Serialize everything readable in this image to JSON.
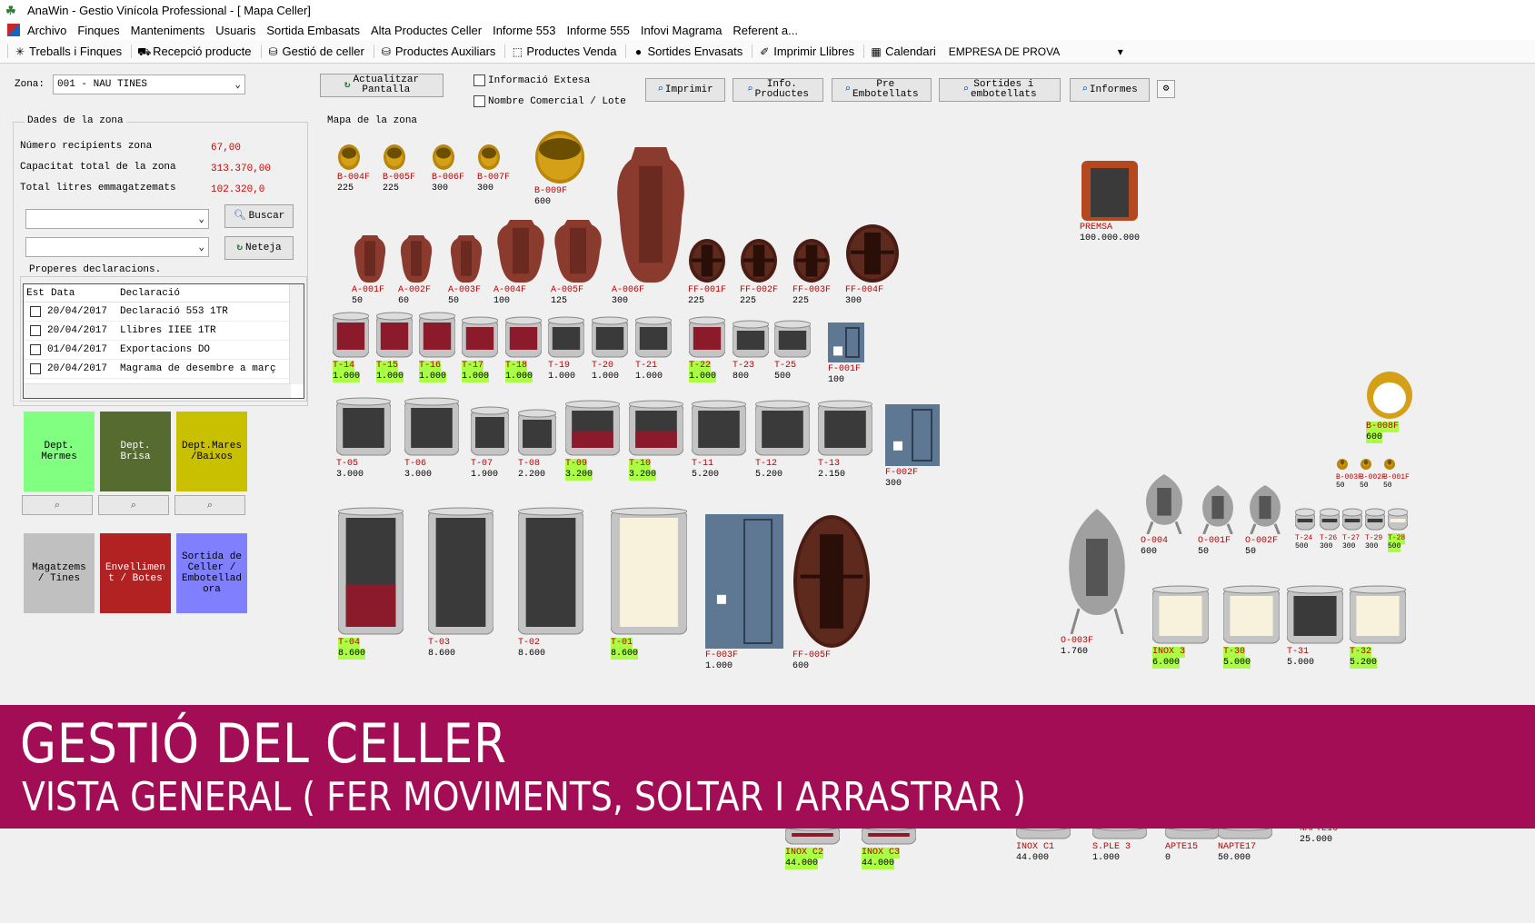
{
  "window": {
    "title": "AnaWin - Gestio Vinícola Professional - [   Mapa Celler]"
  },
  "menu": [
    "Archivo",
    "Finques",
    "Manteniments",
    "Usuaris",
    "Sortida Embasats",
    "Alta Productes Celler",
    "Informe 553",
    "Informe 555",
    "Infovi Magrama",
    "Referent a..."
  ],
  "toolbar": {
    "items": [
      {
        "label": "Treballs i Finques",
        "icon": "gear-icon"
      },
      {
        "label": "Recepció producte",
        "icon": "tractor-icon"
      },
      {
        "label": "Gestió de celler",
        "icon": "barrel-icon"
      },
      {
        "label": "Productes Auxiliars",
        "icon": "barrel-icon"
      },
      {
        "label": "Productes Venda",
        "icon": "box-icon"
      },
      {
        "label": "Sortides Envasats",
        "icon": "sale-icon"
      },
      {
        "label": "Imprimir Llibres",
        "icon": "book-icon"
      },
      {
        "label": "Calendari",
        "icon": "calendar-icon"
      }
    ],
    "company": "EMPRESA DE PROVA"
  },
  "top": {
    "zona_label": "Zona:",
    "zona_value": "001 - NAU TINES",
    "refresh_btn": [
      "Actualitzar",
      "Pantalla"
    ],
    "check_info": "Informació Extesa",
    "check_nom": "Nombre Comercial / Lote",
    "buttons": [
      {
        "l1": "Imprimir",
        "l2": ""
      },
      {
        "l1": "Info.",
        "l2": "Productes"
      },
      {
        "l1": "Pre",
        "l2": "Embotellats"
      },
      {
        "l1": "Sortides i",
        "l2": "embotellats"
      },
      {
        "l1": "Informes",
        "l2": ""
      }
    ]
  },
  "zone_data": {
    "title": "Dades de la zona",
    "rows": [
      {
        "label": "Número recipients zona",
        "value": "67,00"
      },
      {
        "label": "Capacitat total de la zona",
        "value": "313.370,00"
      },
      {
        "label": "Total litres emmagatzemats",
        "value": "102.320,0"
      }
    ],
    "buscar": "Buscar",
    "neteja": "Neteja"
  },
  "declarations": {
    "title": "Properes declaracions.",
    "headers": [
      "Est",
      "Data",
      "Declaració"
    ],
    "rows": [
      {
        "date": "20/04/2017",
        "text": "Declaració 553 1TR"
      },
      {
        "date": "20/04/2017",
        "text": "Llibres IIEE 1TR"
      },
      {
        "date": "01/04/2017",
        "text": "Exportacions DO"
      },
      {
        "date": "20/04/2017",
        "text": "Magrama de desembre a març"
      }
    ]
  },
  "depts": [
    {
      "label": "Dept.\nMermes",
      "color": "#80ff80"
    },
    {
      "label": "Dept.\nBrisa",
      "color": "#556b2f"
    },
    {
      "label": "Dept.Mares\n/Baixos",
      "color": "#c8c000"
    },
    {
      "label": "Magatzems\n/ Tines",
      "color": "#c0c0c0"
    },
    {
      "label": "Envellimen\nt / Botes",
      "color": "#b22222"
    },
    {
      "label": "Sortida de\nCeller /\nEmbotellad\nora",
      "color": "#8080ff"
    }
  ],
  "map_title": "Mapa de la zona",
  "vessels": [
    {
      "code": "B-004F",
      "cap": "225",
      "type": "barrel-small",
      "hl": false
    },
    {
      "code": "B-005F",
      "cap": "225",
      "type": "barrel-small",
      "hl": false
    },
    {
      "code": "B-006F",
      "cap": "300",
      "type": "barrel-small",
      "hl": false
    },
    {
      "code": "B-007F",
      "cap": "300",
      "type": "barrel-small",
      "hl": false
    },
    {
      "code": "B-009F",
      "cap": "600",
      "type": "barrel-big",
      "hl": false
    },
    {
      "code": "A-001F",
      "cap": "50",
      "type": "amphora",
      "hl": false
    },
    {
      "code": "A-002F",
      "cap": "60",
      "type": "amphora",
      "hl": false
    },
    {
      "code": "A-003F",
      "cap": "50",
      "type": "amphora",
      "hl": false
    },
    {
      "code": "A-004F",
      "cap": "100",
      "type": "amphora",
      "hl": false
    },
    {
      "code": "A-005F",
      "cap": "125",
      "type": "amphora",
      "hl": false
    },
    {
      "code": "A-006F",
      "cap": "300",
      "type": "amphora",
      "hl": false
    },
    {
      "code": "FF-001F",
      "cap": "225",
      "type": "foudre",
      "hl": false
    },
    {
      "code": "FF-002F",
      "cap": "225",
      "type": "foudre",
      "hl": false
    },
    {
      "code": "FF-003F",
      "cap": "225",
      "type": "foudre",
      "hl": false
    },
    {
      "code": "FF-004F",
      "cap": "300",
      "type": "foudre",
      "hl": false
    },
    {
      "code": "PREMSA",
      "cap": "100.000.000",
      "type": "press",
      "hl": false
    },
    {
      "code": "T-14",
      "cap": "1.000",
      "type": "tank-red",
      "hl": true
    },
    {
      "code": "T-15",
      "cap": "1.000",
      "type": "tank-red",
      "hl": true
    },
    {
      "code": "T-16",
      "cap": "1.000",
      "type": "tank-red",
      "hl": true
    },
    {
      "code": "T-17",
      "cap": "1.000",
      "type": "tank-red",
      "hl": true
    },
    {
      "code": "T-18",
      "cap": "1.000",
      "type": "tank-red",
      "hl": true
    },
    {
      "code": "T-19",
      "cap": "1.000",
      "type": "tank",
      "hl": false
    },
    {
      "code": "T-20",
      "cap": "1.000",
      "type": "tank",
      "hl": false
    },
    {
      "code": "T-21",
      "cap": "1.000",
      "type": "tank",
      "hl": false
    },
    {
      "code": "T-22",
      "cap": "1.000",
      "type": "tank-red",
      "hl": true
    },
    {
      "code": "T-23",
      "cap": "800",
      "type": "tank",
      "hl": false
    },
    {
      "code": "T-25",
      "cap": "500",
      "type": "tank",
      "hl": false
    },
    {
      "code": "F-001F",
      "cap": "100",
      "type": "fridge",
      "hl": false
    },
    {
      "code": "T-05",
      "cap": "3.000",
      "type": "tank",
      "hl": false
    },
    {
      "code": "T-06",
      "cap": "3.000",
      "type": "tank",
      "hl": false
    },
    {
      "code": "T-07",
      "cap": "1.900",
      "type": "tank",
      "hl": false
    },
    {
      "code": "T-08",
      "cap": "2.200",
      "type": "tank",
      "hl": false
    },
    {
      "code": "T-09",
      "cap": "3.200",
      "type": "tank-half",
      "hl": true
    },
    {
      "code": "T-10",
      "cap": "3.200",
      "type": "tank-half",
      "hl": true
    },
    {
      "code": "T-11",
      "cap": "5.200",
      "type": "tank",
      "hl": false
    },
    {
      "code": "T-12",
      "cap": "5.200",
      "type": "tank",
      "hl": false
    },
    {
      "code": "T-13",
      "cap": "2.150",
      "type": "tank",
      "hl": false
    },
    {
      "code": "F-002F",
      "cap": "300",
      "type": "fridge",
      "hl": false
    },
    {
      "code": "B-008F",
      "cap": "600",
      "type": "barrel-ring",
      "hl": true
    },
    {
      "code": "B-003F",
      "cap": "50",
      "type": "barrel-mini",
      "hl": false
    },
    {
      "code": "B-002F",
      "cap": "50",
      "type": "barrel-mini",
      "hl": false
    },
    {
      "code": "B-001F",
      "cap": "50",
      "type": "barrel-mini",
      "hl": false
    },
    {
      "code": "T-04",
      "cap": "8.600",
      "type": "tank-big-red",
      "hl": true
    },
    {
      "code": "T-03",
      "cap": "8.600",
      "type": "tank-big",
      "hl": false
    },
    {
      "code": "T-02",
      "cap": "8.600",
      "type": "tank-big",
      "hl": false
    },
    {
      "code": "T-01",
      "cap": "8.600",
      "type": "tank-big-white",
      "hl": true
    },
    {
      "code": "F-003F",
      "cap": "1.000",
      "type": "fridge",
      "hl": false
    },
    {
      "code": "FF-005F",
      "cap": "600",
      "type": "foudre-oval",
      "hl": false
    },
    {
      "code": "O-004",
      "cap": "600",
      "type": "egg",
      "hl": false
    },
    {
      "code": "O-001F",
      "cap": "50",
      "type": "egg",
      "hl": false
    },
    {
      "code": "O-002F",
      "cap": "50",
      "type": "egg",
      "hl": false
    },
    {
      "code": "O-003F",
      "cap": "1.760",
      "type": "egg",
      "hl": false
    },
    {
      "code": "T-24",
      "cap": "500",
      "type": "tank",
      "hl": false
    },
    {
      "code": "T-26",
      "cap": "300",
      "type": "tank",
      "hl": false
    },
    {
      "code": "T-27",
      "cap": "300",
      "type": "tank",
      "hl": false
    },
    {
      "code": "T-29",
      "cap": "300",
      "type": "tank",
      "hl": false
    },
    {
      "code": "T-28",
      "cap": "500",
      "type": "tank-white",
      "hl": true
    },
    {
      "code": "INOX 3",
      "cap": "6.000",
      "type": "tank-white",
      "hl": true
    },
    {
      "code": "T-30",
      "cap": "5.000",
      "type": "tank-white",
      "hl": true
    },
    {
      "code": "T-31",
      "cap": "5.000",
      "type": "tank",
      "hl": false
    },
    {
      "code": "T-32",
      "cap": "5.200",
      "type": "tank-white",
      "hl": true
    },
    {
      "code": "INOX C2",
      "cap": "44.000",
      "type": "tank-red",
      "hl": true
    },
    {
      "code": "INOX C3",
      "cap": "44.000",
      "type": "tank-red",
      "hl": true
    },
    {
      "code": "INOX C1",
      "cap": "44.000",
      "type": "tank",
      "hl": false
    },
    {
      "code": "S.PLE 3",
      "cap": "1.000",
      "type": "tank",
      "hl": false
    },
    {
      "code": "APTE15",
      "cap": "0",
      "type": "tank",
      "hl": false
    },
    {
      "code": "NAPTE17",
      "cap": "50.000",
      "type": "tank",
      "hl": false
    },
    {
      "code": "NAPTE16",
      "cap": "25.000",
      "type": "tank",
      "hl": false
    }
  ],
  "banner": {
    "title": "GESTIÓ DEL CELLER",
    "subtitle": "VISTA GENERAL ( FER MOVIMENTS, SOLTAR I ARRASTRAR )"
  }
}
